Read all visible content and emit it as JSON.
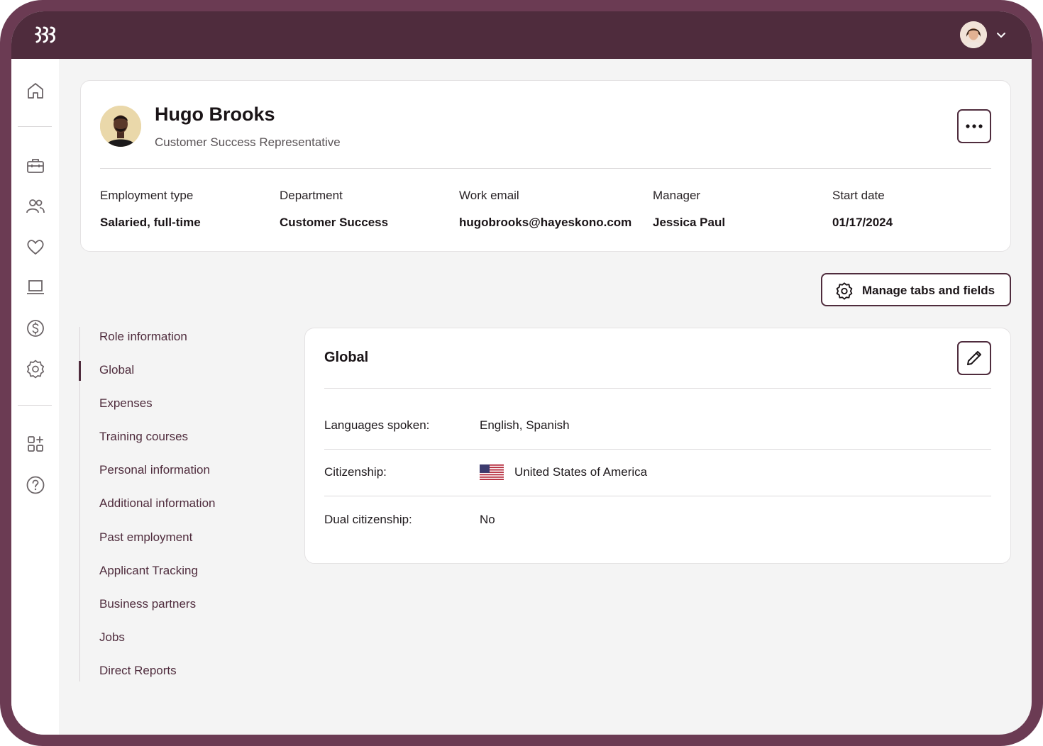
{
  "colors": {
    "frame": "#6b3b53",
    "topbar": "#4f2c3d",
    "accent": "#4f2c3d",
    "background": "#f4f4f4",
    "card": "#ffffff"
  },
  "topbar": {
    "logo_icon": "rippling-logo-icon",
    "user_avatar_icon": "user-avatar",
    "account_menu_icon": "chevron-down-icon"
  },
  "sidenav": {
    "items": [
      {
        "icon": "home-icon"
      },
      {
        "icon": "briefcase-icon"
      },
      {
        "icon": "people-icon"
      },
      {
        "icon": "heart-icon"
      },
      {
        "icon": "laptop-icon"
      },
      {
        "icon": "dollar-icon"
      },
      {
        "icon": "settings-icon"
      },
      {
        "icon": "apps-add-icon"
      },
      {
        "icon": "help-icon"
      }
    ]
  },
  "profile": {
    "name": "Hugo Brooks",
    "title": "Customer Success Representative",
    "more_icon": "more-horizontal-icon",
    "fields": [
      {
        "label": "Employment type",
        "value": "Salaried, full-time"
      },
      {
        "label": "Department",
        "value": "Customer Success"
      },
      {
        "label": "Work email",
        "value": "hugobrooks@hayeskono.com"
      },
      {
        "label": "Manager",
        "value": "Jessica Paul"
      },
      {
        "label": "Start date",
        "value": "01/17/2024"
      }
    ]
  },
  "manage_button": {
    "label": "Manage tabs and fields",
    "icon": "gear-icon"
  },
  "tabs": {
    "active": "Global",
    "items": [
      "Role information",
      "Global",
      "Expenses",
      "Training courses",
      "Personal information",
      "Additional information",
      "Past employment",
      "Applicant Tracking",
      "Business partners",
      "Jobs",
      "Direct Reports"
    ]
  },
  "detail": {
    "title": "Global",
    "edit_icon": "pencil-icon",
    "rows": [
      {
        "label": "Languages spoken:",
        "value": "English, Spanish"
      },
      {
        "label": "Citizenship:",
        "value": "United States of America",
        "flag": "us-flag-icon"
      },
      {
        "label": "Dual citizenship:",
        "value": "No"
      }
    ]
  }
}
